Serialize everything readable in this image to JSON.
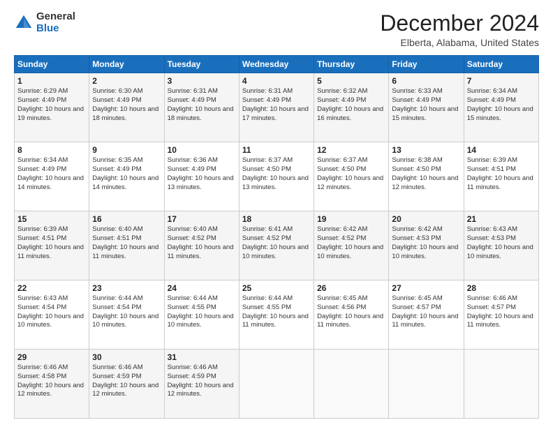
{
  "logo": {
    "general": "General",
    "blue": "Blue"
  },
  "title": "December 2024",
  "subtitle": "Elberta, Alabama, United States",
  "weekdays": [
    "Sunday",
    "Monday",
    "Tuesday",
    "Wednesday",
    "Thursday",
    "Friday",
    "Saturday"
  ],
  "weeks": [
    [
      {
        "day": "1",
        "sunrise": "6:29 AM",
        "sunset": "4:49 PM",
        "daylight": "10 hours and 19 minutes."
      },
      {
        "day": "2",
        "sunrise": "6:30 AM",
        "sunset": "4:49 PM",
        "daylight": "10 hours and 18 minutes."
      },
      {
        "day": "3",
        "sunrise": "6:31 AM",
        "sunset": "4:49 PM",
        "daylight": "10 hours and 18 minutes."
      },
      {
        "day": "4",
        "sunrise": "6:31 AM",
        "sunset": "4:49 PM",
        "daylight": "10 hours and 17 minutes."
      },
      {
        "day": "5",
        "sunrise": "6:32 AM",
        "sunset": "4:49 PM",
        "daylight": "10 hours and 16 minutes."
      },
      {
        "day": "6",
        "sunrise": "6:33 AM",
        "sunset": "4:49 PM",
        "daylight": "10 hours and 15 minutes."
      },
      {
        "day": "7",
        "sunrise": "6:34 AM",
        "sunset": "4:49 PM",
        "daylight": "10 hours and 15 minutes."
      }
    ],
    [
      {
        "day": "8",
        "sunrise": "6:34 AM",
        "sunset": "4:49 PM",
        "daylight": "10 hours and 14 minutes."
      },
      {
        "day": "9",
        "sunrise": "6:35 AM",
        "sunset": "4:49 PM",
        "daylight": "10 hours and 14 minutes."
      },
      {
        "day": "10",
        "sunrise": "6:36 AM",
        "sunset": "4:49 PM",
        "daylight": "10 hours and 13 minutes."
      },
      {
        "day": "11",
        "sunrise": "6:37 AM",
        "sunset": "4:50 PM",
        "daylight": "10 hours and 13 minutes."
      },
      {
        "day": "12",
        "sunrise": "6:37 AM",
        "sunset": "4:50 PM",
        "daylight": "10 hours and 12 minutes."
      },
      {
        "day": "13",
        "sunrise": "6:38 AM",
        "sunset": "4:50 PM",
        "daylight": "10 hours and 12 minutes."
      },
      {
        "day": "14",
        "sunrise": "6:39 AM",
        "sunset": "4:51 PM",
        "daylight": "10 hours and 11 minutes."
      }
    ],
    [
      {
        "day": "15",
        "sunrise": "6:39 AM",
        "sunset": "4:51 PM",
        "daylight": "10 hours and 11 minutes."
      },
      {
        "day": "16",
        "sunrise": "6:40 AM",
        "sunset": "4:51 PM",
        "daylight": "10 hours and 11 minutes."
      },
      {
        "day": "17",
        "sunrise": "6:40 AM",
        "sunset": "4:52 PM",
        "daylight": "10 hours and 11 minutes."
      },
      {
        "day": "18",
        "sunrise": "6:41 AM",
        "sunset": "4:52 PM",
        "daylight": "10 hours and 10 minutes."
      },
      {
        "day": "19",
        "sunrise": "6:42 AM",
        "sunset": "4:52 PM",
        "daylight": "10 hours and 10 minutes."
      },
      {
        "day": "20",
        "sunrise": "6:42 AM",
        "sunset": "4:53 PM",
        "daylight": "10 hours and 10 minutes."
      },
      {
        "day": "21",
        "sunrise": "6:43 AM",
        "sunset": "4:53 PM",
        "daylight": "10 hours and 10 minutes."
      }
    ],
    [
      {
        "day": "22",
        "sunrise": "6:43 AM",
        "sunset": "4:54 PM",
        "daylight": "10 hours and 10 minutes."
      },
      {
        "day": "23",
        "sunrise": "6:44 AM",
        "sunset": "4:54 PM",
        "daylight": "10 hours and 10 minutes."
      },
      {
        "day": "24",
        "sunrise": "6:44 AM",
        "sunset": "4:55 PM",
        "daylight": "10 hours and 10 minutes."
      },
      {
        "day": "25",
        "sunrise": "6:44 AM",
        "sunset": "4:55 PM",
        "daylight": "10 hours and 11 minutes."
      },
      {
        "day": "26",
        "sunrise": "6:45 AM",
        "sunset": "4:56 PM",
        "daylight": "10 hours and 11 minutes."
      },
      {
        "day": "27",
        "sunrise": "6:45 AM",
        "sunset": "4:57 PM",
        "daylight": "10 hours and 11 minutes."
      },
      {
        "day": "28",
        "sunrise": "6:46 AM",
        "sunset": "4:57 PM",
        "daylight": "10 hours and 11 minutes."
      }
    ],
    [
      {
        "day": "29",
        "sunrise": "6:46 AM",
        "sunset": "4:58 PM",
        "daylight": "10 hours and 12 minutes."
      },
      {
        "day": "30",
        "sunrise": "6:46 AM",
        "sunset": "4:59 PM",
        "daylight": "10 hours and 12 minutes."
      },
      {
        "day": "31",
        "sunrise": "6:46 AM",
        "sunset": "4:59 PM",
        "daylight": "10 hours and 12 minutes."
      },
      null,
      null,
      null,
      null
    ]
  ]
}
